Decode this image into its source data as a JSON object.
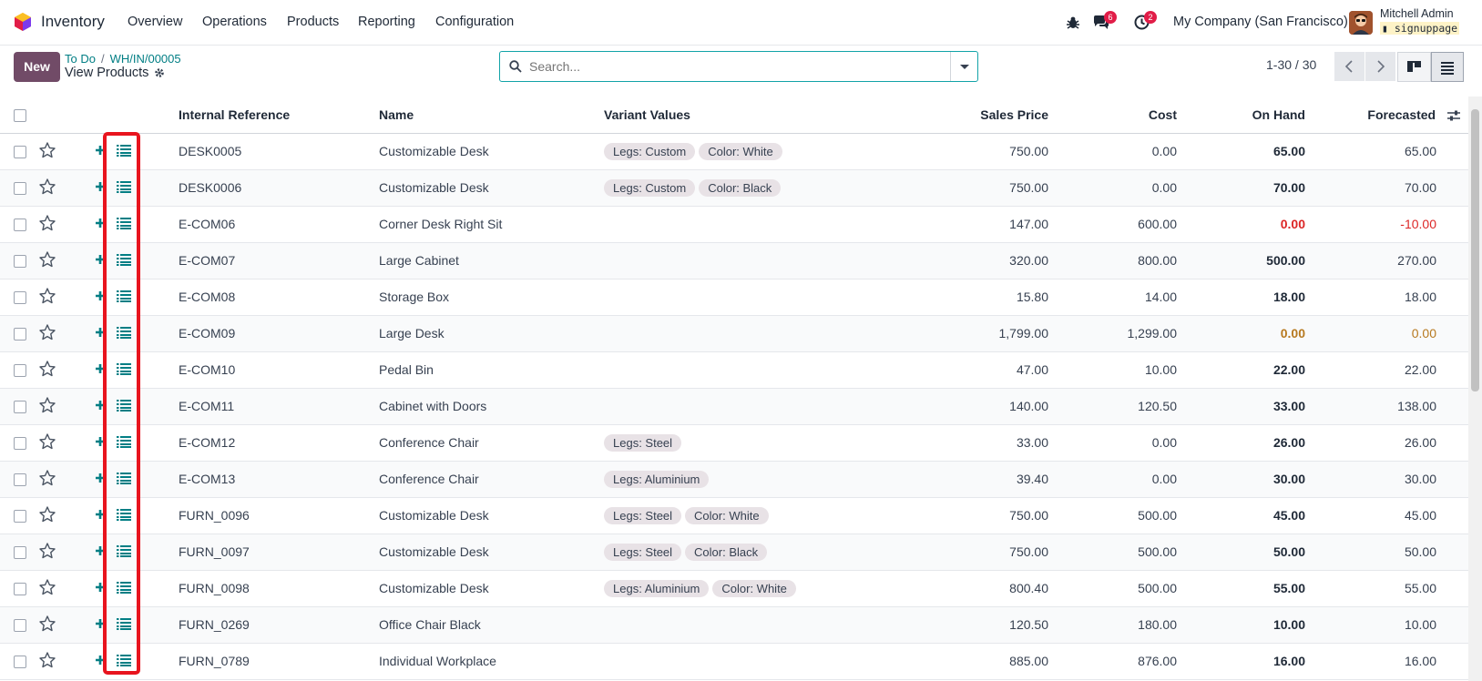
{
  "app": {
    "name": "Inventory"
  },
  "menu": [
    "Overview",
    "Operations",
    "Products",
    "Reporting",
    "Configuration"
  ],
  "systray": {
    "debug_icon": "bug-icon",
    "messages_count": "6",
    "activity_count": "2",
    "company": "My Company (San Francisco)",
    "user_name": "Mitchell Admin",
    "database": "signuppage"
  },
  "control": {
    "new_label": "New",
    "breadcrumb": [
      "To Do",
      "WH/IN/00005"
    ],
    "title": "View Products",
    "search_placeholder": "Search...",
    "pager": "1-30 / 30"
  },
  "table": {
    "headers": [
      "Internal Reference",
      "Name",
      "Variant Values",
      "Sales Price",
      "Cost",
      "On Hand",
      "Forecasted"
    ],
    "rows": [
      {
        "ref": "DESK0005",
        "name": "Customizable Desk",
        "tags": [
          "Legs: Custom",
          "Color: White"
        ],
        "price": "750.00",
        "cost": "0.00",
        "onhand": "65.00",
        "forecast": "65.00",
        "status": ""
      },
      {
        "ref": "DESK0006",
        "name": "Customizable Desk",
        "tags": [
          "Legs: Custom",
          "Color: Black"
        ],
        "price": "750.00",
        "cost": "0.00",
        "onhand": "70.00",
        "forecast": "70.00",
        "status": ""
      },
      {
        "ref": "E-COM06",
        "name": "Corner Desk Right Sit",
        "tags": [],
        "price": "147.00",
        "cost": "600.00",
        "onhand": "0.00",
        "forecast": "-10.00",
        "status": "red"
      },
      {
        "ref": "E-COM07",
        "name": "Large Cabinet",
        "tags": [],
        "price": "320.00",
        "cost": "800.00",
        "onhand": "500.00",
        "forecast": "270.00",
        "status": ""
      },
      {
        "ref": "E-COM08",
        "name": "Storage Box",
        "tags": [],
        "price": "15.80",
        "cost": "14.00",
        "onhand": "18.00",
        "forecast": "18.00",
        "status": ""
      },
      {
        "ref": "E-COM09",
        "name": "Large Desk",
        "tags": [],
        "price": "1,799.00",
        "cost": "1,299.00",
        "onhand": "0.00",
        "forecast": "0.00",
        "status": "amber"
      },
      {
        "ref": "E-COM10",
        "name": "Pedal Bin",
        "tags": [],
        "price": "47.00",
        "cost": "10.00",
        "onhand": "22.00",
        "forecast": "22.00",
        "status": ""
      },
      {
        "ref": "E-COM11",
        "name": "Cabinet with Doors",
        "tags": [],
        "price": "140.00",
        "cost": "120.50",
        "onhand": "33.00",
        "forecast": "138.00",
        "status": ""
      },
      {
        "ref": "E-COM12",
        "name": "Conference Chair",
        "tags": [
          "Legs: Steel"
        ],
        "price": "33.00",
        "cost": "0.00",
        "onhand": "26.00",
        "forecast": "26.00",
        "status": ""
      },
      {
        "ref": "E-COM13",
        "name": "Conference Chair",
        "tags": [
          "Legs: Aluminium"
        ],
        "price": "39.40",
        "cost": "0.00",
        "onhand": "30.00",
        "forecast": "30.00",
        "status": ""
      },
      {
        "ref": "FURN_0096",
        "name": "Customizable Desk",
        "tags": [
          "Legs: Steel",
          "Color: White"
        ],
        "price": "750.00",
        "cost": "500.00",
        "onhand": "45.00",
        "forecast": "45.00",
        "status": ""
      },
      {
        "ref": "FURN_0097",
        "name": "Customizable Desk",
        "tags": [
          "Legs: Steel",
          "Color: Black"
        ],
        "price": "750.00",
        "cost": "500.00",
        "onhand": "50.00",
        "forecast": "50.00",
        "status": ""
      },
      {
        "ref": "FURN_0098",
        "name": "Customizable Desk",
        "tags": [
          "Legs: Aluminium",
          "Color: White"
        ],
        "price": "800.40",
        "cost": "500.00",
        "onhand": "55.00",
        "forecast": "55.00",
        "status": ""
      },
      {
        "ref": "FURN_0269",
        "name": "Office Chair Black",
        "tags": [],
        "price": "120.50",
        "cost": "180.00",
        "onhand": "10.00",
        "forecast": "10.00",
        "status": ""
      },
      {
        "ref": "FURN_0789",
        "name": "Individual Workplace",
        "tags": [],
        "price": "885.00",
        "cost": "876.00",
        "onhand": "16.00",
        "forecast": "16.00",
        "status": ""
      }
    ]
  },
  "colors": {
    "brand": "#714b67",
    "accent": "#017e84",
    "highlight": "#e8141e",
    "danger": "#dc2626",
    "warning": "#b7791f"
  }
}
